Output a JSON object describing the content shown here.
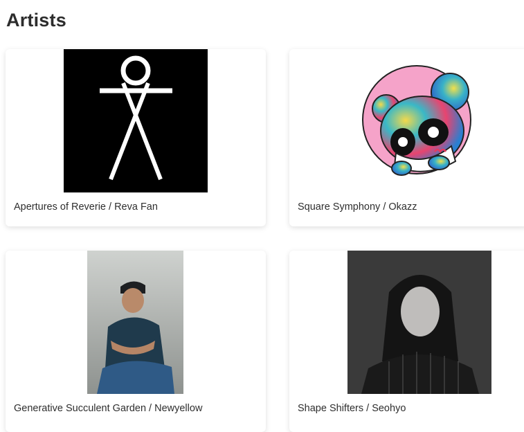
{
  "page": {
    "title": "Artists"
  },
  "artists": [
    {
      "label": "Apertures of Reverie / Reva Fan",
      "image": "stick-figure-logo"
    },
    {
      "label": "Square Symphony / Okazz",
      "image": "colorful-panda-illustration"
    },
    {
      "label": "Generative Succulent Garden / Newyellow",
      "image": "artist-portrait-man"
    },
    {
      "label": "Shape Shifters / Seohyo",
      "image": "artist-portrait-woman"
    }
  ]
}
